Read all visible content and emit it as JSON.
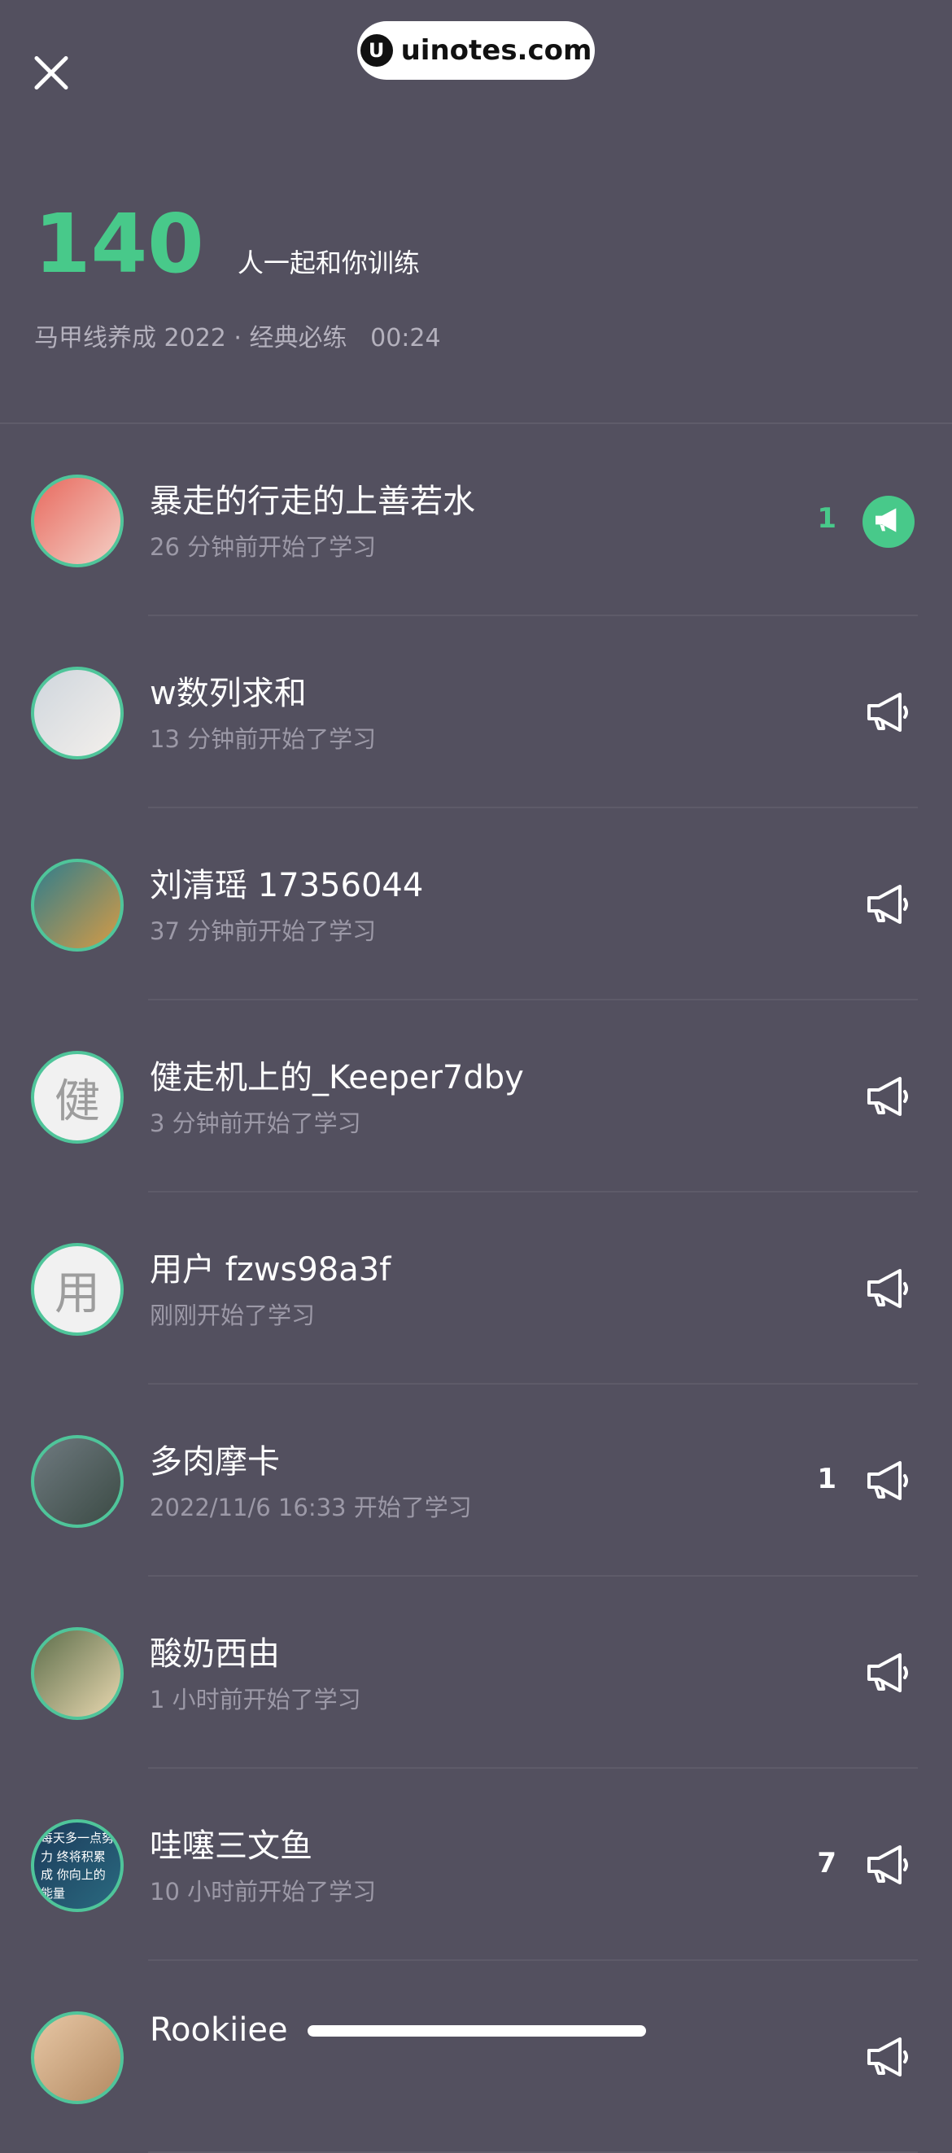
{
  "watermark": {
    "logo": "U",
    "text": "uinotes.com"
  },
  "summary": {
    "count": "140",
    "count_label": "人一起和你训练",
    "course": "马甲线养成 2022 · 经典必练",
    "duration": "00:24"
  },
  "users": [
    {
      "name": "暴走的行走的上善若水",
      "time": "26 分钟前开始了学习",
      "likes": "1",
      "cheered": true,
      "avatar_char": "",
      "avatar_colors": [
        "#e86a5f",
        "#f4d0c6"
      ]
    },
    {
      "name": "w数列求和",
      "time": "13 分钟前开始了学习",
      "likes": "",
      "cheered": false,
      "avatar_char": "",
      "avatar_colors": [
        "#cfd6dd",
        "#f4f0ec"
      ]
    },
    {
      "name": "刘清瑶 17356044",
      "time": "37 分钟前开始了学习",
      "likes": "",
      "cheered": false,
      "avatar_char": "",
      "avatar_colors": [
        "#2f7d8c",
        "#d69b45"
      ]
    },
    {
      "name": "健走机上的_Keeper7dby",
      "time": "3 分钟前开始了学习",
      "likes": "",
      "cheered": false,
      "avatar_char": "健",
      "avatar_colors": [
        "#f1f1f1",
        "#f1f1f1"
      ]
    },
    {
      "name": "用户 fzws98a3f",
      "time": "刚刚开始了学习",
      "likes": "",
      "cheered": false,
      "avatar_char": "用",
      "avatar_colors": [
        "#f1f1f1",
        "#f1f1f1"
      ]
    },
    {
      "name": "多肉摩卡",
      "time": "2022/11/6 16:33 开始了学习",
      "likes": "1",
      "cheered": false,
      "avatar_char": "",
      "avatar_colors": [
        "#6f7a80",
        "#3b4a44"
      ]
    },
    {
      "name": "酸奶西由",
      "time": "1 小时前开始了学习",
      "likes": "",
      "cheered": false,
      "avatar_char": "",
      "avatar_colors": [
        "#5d6e4b",
        "#e9d8b0"
      ]
    },
    {
      "name": "哇噻三文鱼",
      "time": "10 小时前开始了学习",
      "likes": "7",
      "cheered": false,
      "avatar_char": "",
      "avatar_colors": [
        "#1c3a5a",
        "#2a6a80"
      ],
      "avatar_text": "每天多一点努力 终将积累成 你向上的能量"
    },
    {
      "name": "Rookiiee",
      "time": "",
      "likes": "",
      "cheered": false,
      "avatar_char": "",
      "avatar_colors": [
        "#e7c7a5",
        "#b38a62"
      ]
    }
  ],
  "colors": {
    "background": "#53505f",
    "accent": "#48c98a",
    "avatar_ring": "#4fc59a"
  },
  "icons": {
    "close": "close-icon",
    "cheer": "megaphone-icon"
  }
}
